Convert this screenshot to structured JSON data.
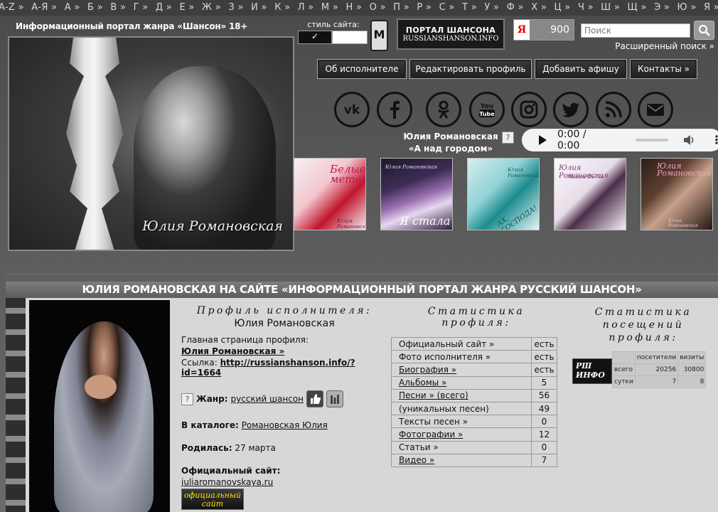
{
  "alphabet": [
    "A-Z »",
    "А-Я »",
    "А »",
    "Б »",
    "В »",
    "Г »",
    "Д »",
    "Е »",
    "Ж »",
    "З »",
    "И »",
    "К »",
    "Л »",
    "М »",
    "Н »",
    "О »",
    "П »",
    "Р »",
    "С »",
    "Т »",
    "У »",
    "Ф »",
    "Х »",
    "Ц »",
    "Ч »",
    "Ш »",
    "Щ »",
    "Э »",
    "Ю »",
    "Я »"
  ],
  "header": {
    "site_title": "Информационный портал жанра «Шансон»    18+",
    "photo_signature": "Юлия Романовская",
    "style_label": "стиль сайта:",
    "style_check": "✓",
    "mobile_icon": "M",
    "portal_logo_line1": "ПОРТАЛ ШАНСОНА",
    "portal_logo_line2": "RUSSIANSHANSON.INFO",
    "ya_letter": "Я",
    "ya_count": "900",
    "search_placeholder": "Поиск",
    "advanced_search": "Расширенный поиск »"
  },
  "nav": [
    "Об исполнителе",
    "Редактировать профиль",
    "Добавить афишу",
    "Контакты »"
  ],
  "social_icons": [
    "vk-icon",
    "facebook-icon",
    "odnoklassniki-icon",
    "youtube-icon",
    "instagram-icon",
    "twitter-icon",
    "rss-icon",
    "email-icon"
  ],
  "player": {
    "artist": "Юлия Романовская",
    "title": "«А над городом»",
    "help": "?",
    "time": "0:00 / 0:00"
  },
  "albums": [
    {
      "title": "Белые метели",
      "color": "#e44b63"
    },
    {
      "title": "Я стала",
      "color": "#6b4a8e"
    },
    {
      "title": "АХ, ГОСПОДА!",
      "color": "#39a8a8"
    },
    {
      "title": "Юлия Романовская",
      "color": "#e6dce6"
    },
    {
      "title": "Юлия Романовская",
      "color": "#3a2a25"
    }
  ],
  "album_captions": [
    "Юлия Романовская",
    "Юлия Романовская",
    "Юлия Романовская",
    "Мадам Ля-Ля",
    "Юлия Романовская"
  ],
  "banner": "ЮЛИЯ РОМАНОВСКАЯ НА САЙТЕ «ИНФОРМАЦИОННЫЙ ПОРТАЛ ЖАНРА РУССКИЙ ШАНСОН»",
  "profile": {
    "heading": "Профиль исполнителя:",
    "name": "Юлия Романовская",
    "main_page_label": "Главная страница профиля:",
    "main_page_link": "Юлия Романовская »",
    "link_label": "Ссылка:",
    "link_url": "http://russianshanson.info/?id=1664",
    "genre_help": "?",
    "genre_label": "Жанр:",
    "genre_value": "русский шансон",
    "catalog_label": "В каталоге:",
    "catalog_value": "Романовская Юлия",
    "born_label": "Родилась:",
    "born_value": "27 марта",
    "official_label": "Официальный сайт:",
    "official_url": "juliaromanovskaya.ru",
    "official_btn": "официальный сайт"
  },
  "stats": {
    "heading": "Статистика профиля:",
    "rows": [
      {
        "label": "Официальный сайт »",
        "value": "есть",
        "link": false
      },
      {
        "label": "Фото исполнителя »",
        "value": "есть",
        "link": false
      },
      {
        "label": "Биография »",
        "value": "есть",
        "link": true
      },
      {
        "label": "Альбомы »",
        "value": "5",
        "link": true
      },
      {
        "label": "Песни » (всего)",
        "value": "56",
        "link": true
      },
      {
        "label": "(уникальных песен)",
        "value": "49",
        "link": false
      },
      {
        "label": "Тексты песен »",
        "value": "0",
        "link": false
      },
      {
        "label": "Фотографии »",
        "value": "12",
        "link": true
      },
      {
        "label": "Статьи »",
        "value": "0",
        "link": false
      },
      {
        "label": "Видео »",
        "value": "7",
        "link": true
      }
    ]
  },
  "visits": {
    "heading": "Статистика посещений профиля:",
    "logo": "РШ ИНФО",
    "col_visitors": "посетители",
    "col_visits": "визиты",
    "row_total_label": "всего",
    "row_total_visitors": "20256",
    "row_total_visits": "30800",
    "row_day_label": "сутки",
    "row_day_visitors": "7",
    "row_day_visits": "8"
  }
}
